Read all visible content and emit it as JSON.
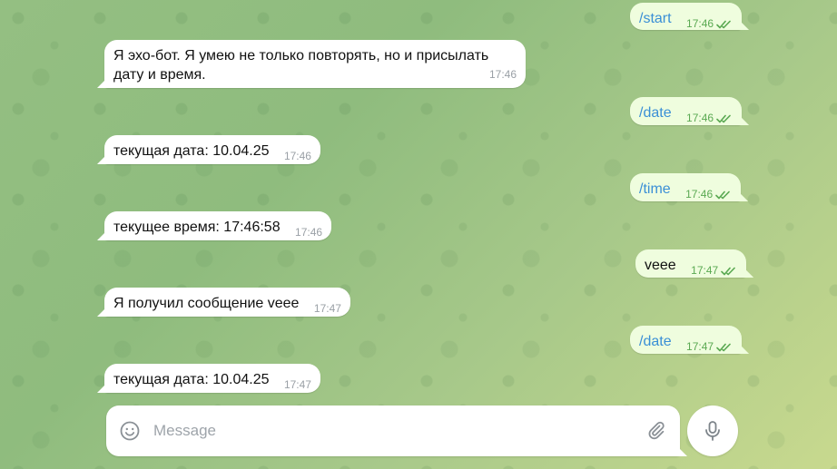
{
  "messages": [
    {
      "dir": "out",
      "text": "/start",
      "time": "17:46",
      "is_command": true
    },
    {
      "dir": "in",
      "text": "Я эхо-бот. Я умею не только повторять, но и присылать дату и время.",
      "time": "17:46"
    },
    {
      "dir": "out",
      "text": "/date",
      "time": "17:46",
      "is_command": true
    },
    {
      "dir": "in",
      "text": "текущая дата: 10.04.25",
      "time": "17:46"
    },
    {
      "dir": "out",
      "text": "/time",
      "time": "17:46",
      "is_command": true
    },
    {
      "dir": "in",
      "text": "текущее время: 17:46:58",
      "time": "17:46"
    },
    {
      "dir": "out",
      "text": "veee",
      "time": "17:47",
      "is_command": false
    },
    {
      "dir": "in",
      "text": "Я получил сообщение veee",
      "time": "17:47"
    },
    {
      "dir": "out",
      "text": "/date",
      "time": "17:47",
      "is_command": true
    },
    {
      "dir": "in",
      "text": "текущая дата: 10.04.25",
      "time": "17:47"
    }
  ],
  "composer": {
    "placeholder": "Message",
    "emoji_icon": "emoji-icon",
    "attach_icon": "paperclip-icon",
    "mic_icon": "microphone-icon"
  },
  "colors": {
    "incoming_bubble": "#ffffff",
    "outgoing_bubble": "#effdde",
    "command_link": "#3a8fd6",
    "outgoing_meta": "#5aa952",
    "incoming_meta": "#9aa0a6"
  }
}
